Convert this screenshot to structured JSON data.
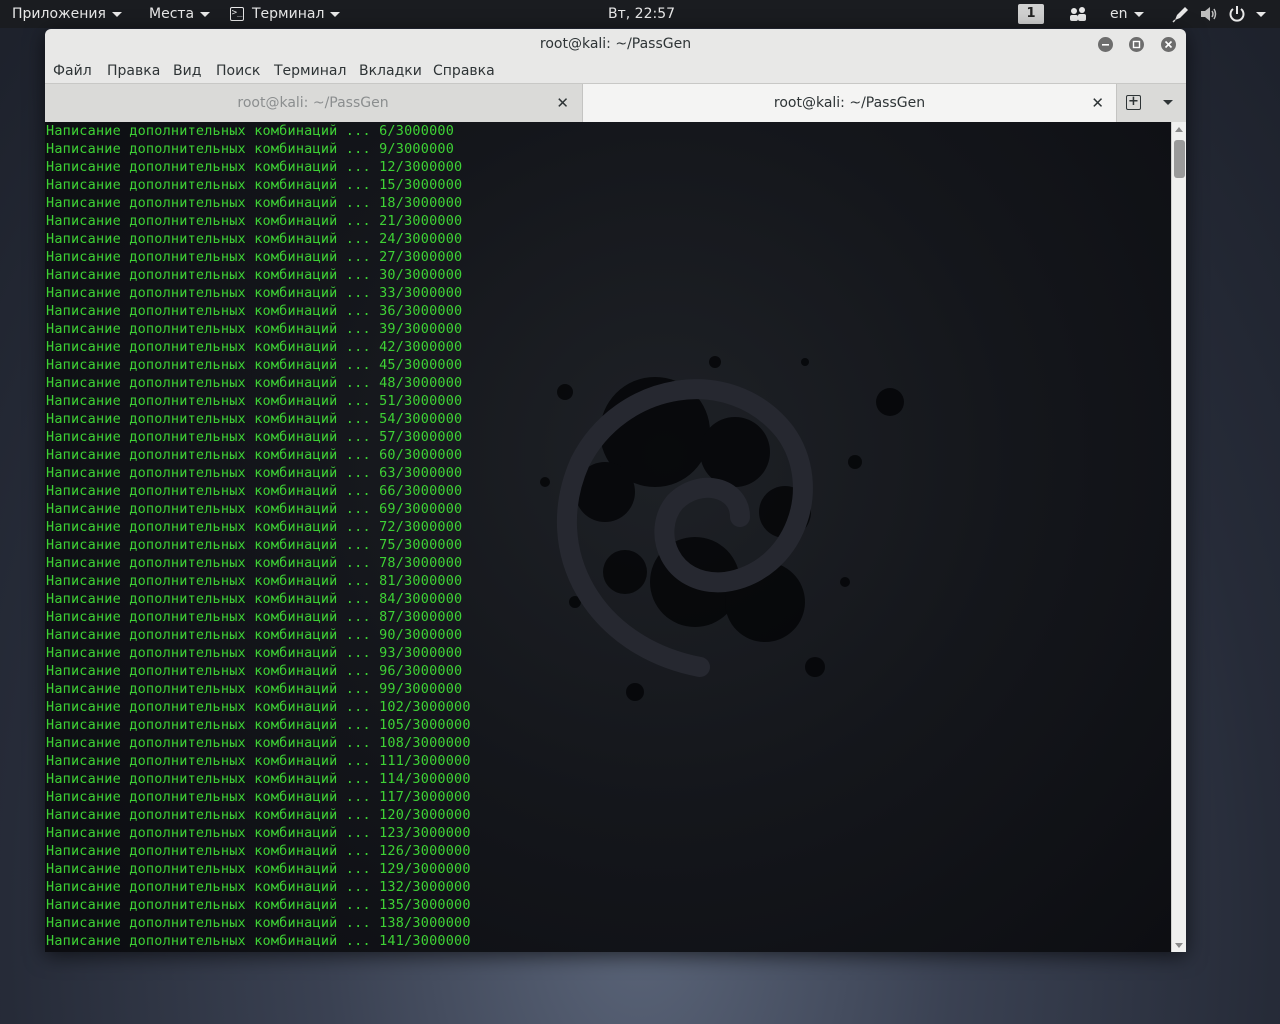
{
  "topbar": {
    "applications": "Приложения",
    "places": "Места",
    "terminal": "Терминал",
    "terminal_icon_glyph": ">_",
    "clock": "Вт, 22:57",
    "workspace": "1",
    "language": "en"
  },
  "window": {
    "title": "root@kali: ~/PassGen",
    "menu": [
      "Файл",
      "Правка",
      "Вид",
      "Поиск",
      "Терминал",
      "Вкладки",
      "Справка"
    ],
    "tabs": [
      {
        "label": "root@kali: ~/PassGen",
        "active": false
      },
      {
        "label": "root@kali: ~/PassGen",
        "active": true
      }
    ]
  },
  "terminal": {
    "lines": [
      "Написание дополнительных комбинаций ... 6/3000000",
      "Написание дополнительных комбинаций ... 9/3000000",
      "Написание дополнительных комбинаций ... 12/3000000",
      "Написание дополнительных комбинаций ... 15/3000000",
      "Написание дополнительных комбинаций ... 18/3000000",
      "Написание дополнительных комбинаций ... 21/3000000",
      "Написание дополнительных комбинаций ... 24/3000000",
      "Написание дополнительных комбинаций ... 27/3000000",
      "Написание дополнительных комбинаций ... 30/3000000",
      "Написание дополнительных комбинаций ... 33/3000000",
      "Написание дополнительных комбинаций ... 36/3000000",
      "Написание дополнительных комбинаций ... 39/3000000",
      "Написание дополнительных комбинаций ... 42/3000000",
      "Написание дополнительных комбинаций ... 45/3000000",
      "Написание дополнительных комбинаций ... 48/3000000",
      "Написание дополнительных комбинаций ... 51/3000000",
      "Написание дополнительных комбинаций ... 54/3000000",
      "Написание дополнительных комбинаций ... 57/3000000",
      "Написание дополнительных комбинаций ... 60/3000000",
      "Написание дополнительных комбинаций ... 63/3000000",
      "Написание дополнительных комбинаций ... 66/3000000",
      "Написание дополнительных комбинаций ... 69/3000000",
      "Написание дополнительных комбинаций ... 72/3000000",
      "Написание дополнительных комбинаций ... 75/3000000",
      "Написание дополнительных комбинаций ... 78/3000000",
      "Написание дополнительных комбинаций ... 81/3000000",
      "Написание дополнительных комбинаций ... 84/3000000",
      "Написание дополнительных комбинаций ... 87/3000000",
      "Написание дополнительных комбинаций ... 90/3000000",
      "Написание дополнительных комбинаций ... 93/3000000",
      "Написание дополнительных комбинаций ... 96/3000000",
      "Написание дополнительных комбинаций ... 99/3000000",
      "Написание дополнительных комбинаций ... 102/3000000",
      "Написание дополнительных комбинаций ... 105/3000000",
      "Написание дополнительных комбинаций ... 108/3000000",
      "Написание дополнительных комбинаций ... 111/3000000",
      "Написание дополнительных комбинаций ... 114/3000000",
      "Написание дополнительных комбинаций ... 117/3000000",
      "Написание дополнительных комбинаций ... 120/3000000",
      "Написание дополнительных комбинаций ... 123/3000000",
      "Написание дополнительных комбинаций ... 126/3000000",
      "Написание дополнительных комбинаций ... 129/3000000",
      "Написание дополнительных комбинаций ... 132/3000000",
      "Написание дополнительных комбинаций ... 135/3000000",
      "Написание дополнительных комбинаций ... 138/3000000",
      "Написание дополнительных комбинаций ... 141/3000000"
    ]
  },
  "colors": {
    "terminal_text": "#3ed235",
    "terminal_bg": "#0b0c10",
    "topbar_bg": "#1a1c20",
    "window_chrome": "#e8e8e7"
  },
  "icons": [
    "caret-down-icon",
    "terminal-app-icon",
    "people-icon",
    "pen-icon",
    "volume-icon",
    "power-icon",
    "close-icon",
    "minimize-icon",
    "maximize-icon",
    "new-tab-icon",
    "tab-menu-icon",
    "debian-swirl-logo"
  ]
}
